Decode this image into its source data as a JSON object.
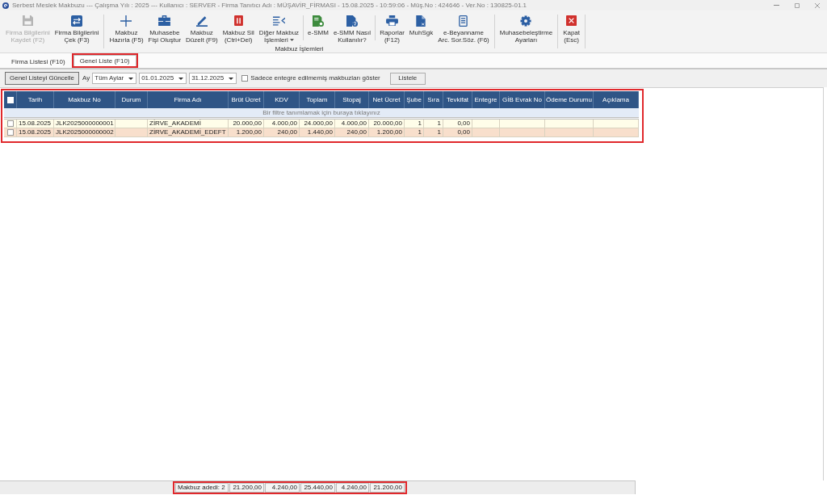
{
  "window": {
    "title": "Serbest Meslek Makbuzu --- Çalışma Yılı : 2025 --- Kullanıcı : SERVER - Firma Tanıtıcı Adı : MÜŞAVİR_FİRMASI - 15.08.2025 - 10:59:06 - Müş.No : 424646 - Ver.No : 130825-01.1"
  },
  "toolbar": {
    "groups": [
      {
        "sections": [
          [
            {
              "label": "Firma Bilgilerini\nKaydet (F2)",
              "kind": "button",
              "disabled": true
            },
            {
              "label": "Firma Bilgilerini\nÇek (F3)",
              "kind": "button",
              "disabled": false
            }
          ]
        ]
      },
      {
        "label": "Makbuz İşlemleri",
        "sections": [
          [
            {
              "label": "Makbuz\nHazırla (F5)",
              "kind": "button",
              "disabled": false
            },
            {
              "label": "Muhasebe\nFişi Oluştur",
              "kind": "button",
              "disabled": false
            },
            {
              "label": "Makbuz\nDüzelt (F9)",
              "kind": "button",
              "disabled": false
            },
            {
              "label": "Makbuz Sil\n(Ctrl+Del)",
              "kind": "button",
              "disabled": false
            },
            {
              "label": "Diğer Makbuz\nİşlemleri",
              "kind": "menu",
              "disabled": false
            }
          ],
          [
            {
              "label": "e-SMM",
              "kind": "button",
              "disabled": false
            },
            {
              "label": "e-SMM Nasıl\nKullanılır?",
              "kind": "button",
              "disabled": false
            }
          ],
          [
            {
              "label": "Raporlar\n(F12)",
              "kind": "button",
              "disabled": false
            },
            {
              "label": "MuhSgk",
              "kind": "button",
              "disabled": false
            },
            {
              "label": "e-Beyanname\nArc. Sor.Söz. (F6)",
              "kind": "button",
              "disabled": false
            }
          ]
        ]
      },
      {
        "sections": [
          [
            {
              "label": "Muhasebeleştirme\nAyarları",
              "kind": "button",
              "disabled": false
            }
          ]
        ]
      },
      {
        "sections": [
          [
            {
              "label": "Kapat\n(Esc)",
              "kind": "button",
              "disabled": false
            }
          ]
        ]
      }
    ]
  },
  "tabs": [
    {
      "label": "Firma Listesi (F10)",
      "selected": false,
      "highlighted": false
    },
    {
      "label": "Genel Liste (F10)",
      "selected": true,
      "highlighted": true
    }
  ],
  "filter_bar": {
    "refresh_button": "Genel Listeyi Güncelle",
    "month": {
      "label": "Ay",
      "value": "Tüm Aylar"
    },
    "start_date": {
      "value": "01.01.2025"
    },
    "end_date": {
      "value": "31.12.2025"
    },
    "only_unintegrated": {
      "label": "Sadece entegre edilmemiş makbuzları göster",
      "checked": false
    },
    "list_button": "Listele"
  },
  "table": {
    "highlighted": true,
    "select_all": {
      "checked": false
    },
    "columns": [
      "Tarih",
      "Makbuz No",
      "Durum",
      "Firma Adı",
      "Brüt Ücret",
      "KDV",
      "Toplam",
      "Stopaj",
      "Net Ücret",
      "Şube",
      "Sıra",
      "Tevkifat",
      "Entegre",
      "GİB Evrak No",
      "Ödeme Durumu",
      "Açıklama"
    ],
    "filter_hint": "Bir filtre tanımlamak için buraya tıklayınız",
    "rows": [
      {
        "checked": false,
        "color": "#fffde9",
        "tarih": "15.08.2025",
        "makbuz_no": "JLK2025000000001",
        "firma_adi": "ZİRVE_AKADEMİ",
        "brut_ucret": "20.000,00",
        "kdv": "4.000,00",
        "toplam": "24.000,00",
        "stopaj": "4.000,00",
        "net_ucret": "20.000,00",
        "sube": "1",
        "sira": "1",
        "tevkifat": "0,00"
      },
      {
        "checked": false,
        "color": "#f8dfcc",
        "tarih": "15.08.2025",
        "makbuz_no": "JLK2025000000002",
        "firma_adi": "ZİRVE_AKADEMİ_EDEFT",
        "brut_ucret": "1.200,00",
        "kdv": "240,00",
        "toplam": "1.440,00",
        "stopaj": "240,00",
        "net_ucret": "1.200,00",
        "sube": "1",
        "sira": "1",
        "tevkifat": "0,00"
      }
    ]
  },
  "summary": {
    "highlighted": true,
    "count": "Makbuz adedi: 2",
    "totals": [
      "21.200,00",
      "4.240,00",
      "25.440,00",
      "4.240,00",
      "21.200,00"
    ]
  }
}
